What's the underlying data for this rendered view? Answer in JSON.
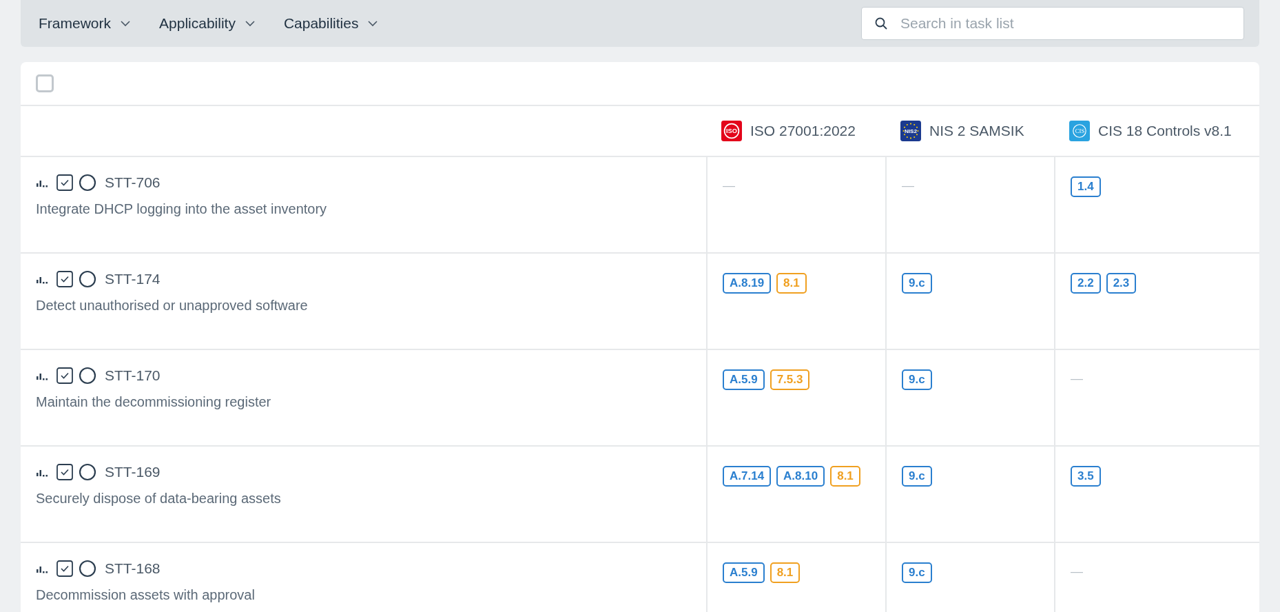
{
  "filters": [
    {
      "label": "Framework"
    },
    {
      "label": "Applicability"
    },
    {
      "label": "Capabilities"
    }
  ],
  "search": {
    "placeholder": "Search in task list"
  },
  "select_all": {
    "checked": false
  },
  "columns": [
    {
      "label": "ISO 27001:2022",
      "kind": "iso",
      "logo_text": "ISO"
    },
    {
      "label": "NIS 2 SAMSIK",
      "kind": "nis",
      "logo_text": "NIS2"
    },
    {
      "label": "CIS 18 Controls v8.1",
      "kind": "cis",
      "logo_text": "CIS"
    }
  ],
  "rows": [
    {
      "id": "STT-706",
      "title": "Integrate DHCP logging into the asset inventory",
      "cells": [
        {
          "empty": "—"
        },
        {
          "empty": "—"
        },
        {
          "tags": [
            {
              "text": "1.4",
              "color": "#2a7fcf"
            }
          ]
        }
      ]
    },
    {
      "id": "STT-174",
      "title": "Detect unauthorised or unapproved software",
      "cells": [
        {
          "tags": [
            {
              "text": "A.8.19",
              "color": "#2a7fcf"
            },
            {
              "text": "8.1",
              "color": "#f0a020"
            }
          ]
        },
        {
          "tags": [
            {
              "text": "9.c",
              "color": "#2a7fcf"
            }
          ]
        },
        {
          "tags": [
            {
              "text": "2.2",
              "color": "#2a7fcf"
            },
            {
              "text": "2.3",
              "color": "#2a7fcf"
            }
          ]
        }
      ]
    },
    {
      "id": "STT-170",
      "title": "Maintain the decommissioning register",
      "cells": [
        {
          "tags": [
            {
              "text": "A.5.9",
              "color": "#2a7fcf"
            },
            {
              "text": "7.5.3",
              "color": "#f0a020"
            }
          ]
        },
        {
          "tags": [
            {
              "text": "9.c",
              "color": "#2a7fcf"
            }
          ]
        },
        {
          "empty": "—"
        }
      ]
    },
    {
      "id": "STT-169",
      "title": "Securely dispose of data-bearing assets",
      "cells": [
        {
          "tags": [
            {
              "text": "A.7.14",
              "color": "#2a7fcf"
            },
            {
              "text": "A.8.10",
              "color": "#2a7fcf"
            },
            {
              "text": "8.1",
              "color": "#f0a020"
            }
          ]
        },
        {
          "tags": [
            {
              "text": "9.c",
              "color": "#2a7fcf"
            }
          ]
        },
        {
          "tags": [
            {
              "text": "3.5",
              "color": "#2a7fcf"
            }
          ]
        }
      ]
    },
    {
      "id": "STT-168",
      "title": "Decommission assets with approval",
      "cells": [
        {
          "tags": [
            {
              "text": "A.5.9",
              "color": "#2a7fcf"
            },
            {
              "text": "8.1",
              "color": "#f0a020"
            }
          ]
        },
        {
          "tags": [
            {
              "text": "9.c",
              "color": "#2a7fcf"
            }
          ]
        },
        {
          "empty": "—"
        }
      ]
    }
  ]
}
